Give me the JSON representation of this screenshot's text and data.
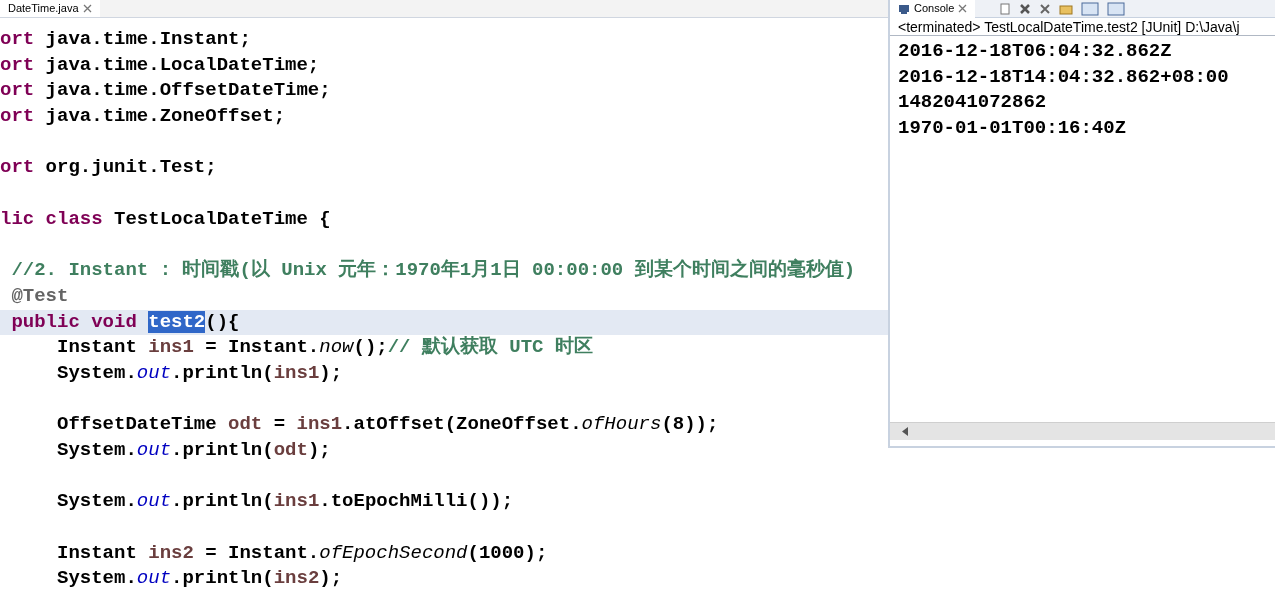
{
  "editor": {
    "tab": {
      "title": "DateTime.java",
      "selected": true
    },
    "lines": [
      {
        "highlighted": false,
        "tokens": [
          {
            "kind": "keyword",
            "text": "ort"
          },
          {
            "kind": "plain",
            "text": " java.time.Instant;"
          }
        ]
      },
      {
        "highlighted": false,
        "tokens": [
          {
            "kind": "keyword",
            "text": "ort"
          },
          {
            "kind": "plain",
            "text": " java.time.LocalDateTime;"
          }
        ]
      },
      {
        "highlighted": false,
        "tokens": [
          {
            "kind": "keyword",
            "text": "ort"
          },
          {
            "kind": "plain",
            "text": " java.time.OffsetDateTime;"
          }
        ]
      },
      {
        "highlighted": false,
        "tokens": [
          {
            "kind": "keyword",
            "text": "ort"
          },
          {
            "kind": "plain",
            "text": " java.time.ZoneOffset;"
          }
        ]
      },
      {
        "highlighted": false
      },
      {
        "highlighted": false,
        "tokens": [
          {
            "kind": "keyword",
            "text": "ort"
          },
          {
            "kind": "plain",
            "text": " org.junit.Test;"
          }
        ]
      },
      {
        "highlighted": false
      },
      {
        "highlighted": false,
        "tokens": [
          {
            "kind": "keyword",
            "text": "lic class"
          },
          {
            "kind": "plain",
            "text": " TestLocalDateTime {"
          }
        ]
      },
      {
        "highlighted": false
      },
      {
        "highlighted": false,
        "tokens": [
          {
            "kind": "comment",
            "text": " //2. Instant : 时间戳(以 Unix 元年：1970年1月1日 00:00:00 到某个时间之间的毫秒值)"
          }
        ]
      },
      {
        "highlighted": false,
        "tokens": [
          {
            "kind": "annotation",
            "text": " @Test"
          }
        ]
      },
      {
        "highlighted": true,
        "tokens": [
          {
            "kind": "keyword",
            "text": " public void "
          },
          {
            "kind": "selection",
            "text": "test2"
          },
          {
            "kind": "plain",
            "text": "(){"
          }
        ]
      },
      {
        "highlighted": false,
        "tokens": [
          {
            "kind": "plain",
            "text": "     Instant "
          },
          {
            "kind": "local",
            "text": "ins1"
          },
          {
            "kind": "plain",
            "text": " = Instant."
          },
          {
            "kind": "static",
            "text": "now"
          },
          {
            "kind": "plain",
            "text": "();"
          },
          {
            "kind": "comment",
            "text": "// 默认获取 UTC 时区"
          }
        ]
      },
      {
        "highlighted": false,
        "tokens": [
          {
            "kind": "plain",
            "text": "     System."
          },
          {
            "kind": "field",
            "text": "out"
          },
          {
            "kind": "plain",
            "text": ".println("
          },
          {
            "kind": "local",
            "text": "ins1"
          },
          {
            "kind": "plain",
            "text": ");"
          }
        ]
      },
      {
        "highlighted": false
      },
      {
        "highlighted": false,
        "tokens": [
          {
            "kind": "plain",
            "text": "     OffsetDateTime "
          },
          {
            "kind": "local",
            "text": "odt"
          },
          {
            "kind": "plain",
            "text": " = "
          },
          {
            "kind": "local",
            "text": "ins1"
          },
          {
            "kind": "plain",
            "text": ".atOffset(ZoneOffset."
          },
          {
            "kind": "static",
            "text": "ofHours"
          },
          {
            "kind": "plain",
            "text": "(8));"
          }
        ]
      },
      {
        "highlighted": false,
        "tokens": [
          {
            "kind": "plain",
            "text": "     System."
          },
          {
            "kind": "field",
            "text": "out"
          },
          {
            "kind": "plain",
            "text": ".println("
          },
          {
            "kind": "local",
            "text": "odt"
          },
          {
            "kind": "plain",
            "text": ");"
          }
        ]
      },
      {
        "highlighted": false
      },
      {
        "highlighted": false,
        "tokens": [
          {
            "kind": "plain",
            "text": "     System."
          },
          {
            "kind": "field",
            "text": "out"
          },
          {
            "kind": "plain",
            "text": ".println("
          },
          {
            "kind": "local",
            "text": "ins1"
          },
          {
            "kind": "plain",
            "text": ".toEpochMilli());"
          }
        ]
      },
      {
        "highlighted": false
      },
      {
        "highlighted": false,
        "tokens": [
          {
            "kind": "plain",
            "text": "     Instant "
          },
          {
            "kind": "local",
            "text": "ins2"
          },
          {
            "kind": "plain",
            "text": " = Instant."
          },
          {
            "kind": "static",
            "text": "ofEpochSecond"
          },
          {
            "kind": "plain",
            "text": "(1000);"
          }
        ]
      },
      {
        "highlighted": false,
        "tokens": [
          {
            "kind": "plain",
            "text": "     System."
          },
          {
            "kind": "field",
            "text": "out"
          },
          {
            "kind": "plain",
            "text": ".println("
          },
          {
            "kind": "local",
            "text": "ins2"
          },
          {
            "kind": "plain",
            "text": ");"
          }
        ]
      }
    ]
  },
  "console": {
    "tab": {
      "title": "Console",
      "selected": true
    },
    "header": "<terminated> TestLocalDateTime.test2 [JUnit] D:\\Java\\j",
    "output": [
      "2016-12-18T06:04:32.862Z",
      "2016-12-18T14:04:32.862+08:00",
      "1482041072862",
      "1970-01-01T00:16:40Z"
    ]
  }
}
